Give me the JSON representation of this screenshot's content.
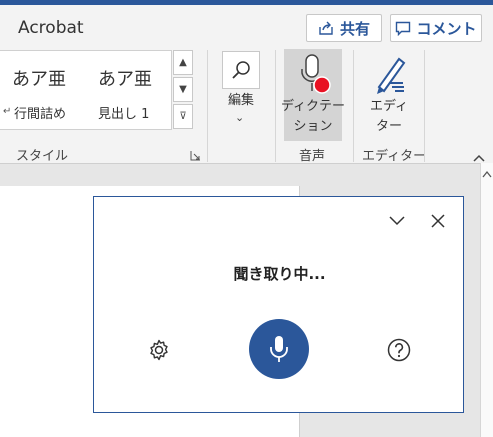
{
  "app": {
    "tab_label": "Acrobat"
  },
  "header": {
    "share_label": "共有",
    "comment_label": "コメント"
  },
  "styles": {
    "items": [
      {
        "sample": "あア亜",
        "label": "行間詰め"
      },
      {
        "sample": "あア亜",
        "label": "見出し 1"
      }
    ],
    "group_label": "スタイル"
  },
  "edit": {
    "label": "編集"
  },
  "voice": {
    "dictate_label_1": "ディクテー",
    "dictate_label_2": "ション",
    "group_label": "音声"
  },
  "editor": {
    "label_1": "エディ",
    "label_2": "ター",
    "group_label": "エディター"
  },
  "dictation_panel": {
    "status": "聞き取り中..."
  },
  "colors": {
    "accent": "#2b579a",
    "record_red": "#e81123"
  }
}
